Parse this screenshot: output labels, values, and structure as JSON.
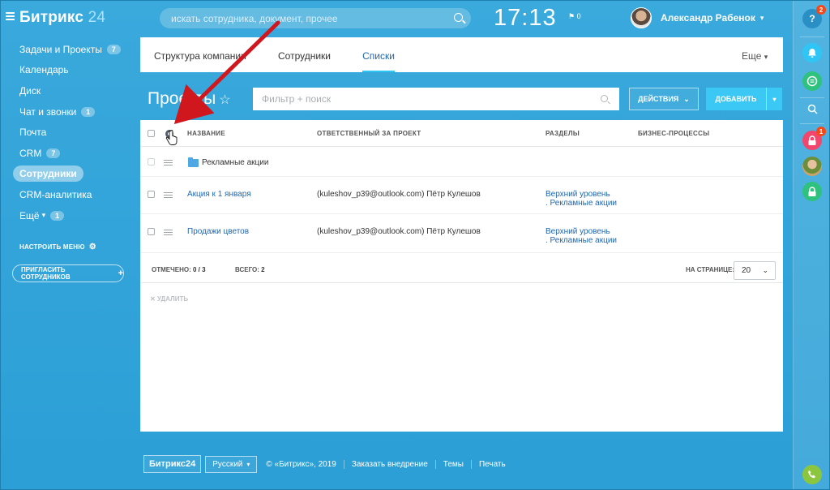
{
  "header": {
    "logo_main": "Битрикс",
    "logo_num": "24",
    "search_placeholder": "искать сотрудника, документ, прочее",
    "clock": "17:13",
    "flag": "⚑ 0",
    "user_name": "Александр Рабенок"
  },
  "menu": {
    "items": [
      {
        "label": "Задачи и Проекты",
        "count": "7"
      },
      {
        "label": "Календарь"
      },
      {
        "label": "Диск"
      },
      {
        "label": "Чат и звонки",
        "count": "1"
      },
      {
        "label": "Почта"
      },
      {
        "label": "CRM",
        "count": "7"
      },
      {
        "label": "Сотрудники",
        "active": true
      },
      {
        "label": "CRM-аналитика"
      },
      {
        "label": "Ещё",
        "count": "1"
      }
    ],
    "setup": "Настроить меню",
    "invite": "Пригласить сотрудников"
  },
  "tabs": {
    "items": [
      "Структура компании",
      "Сотрудники",
      "Списки"
    ],
    "more": "Еще"
  },
  "page": {
    "title": "Проекты",
    "filter_placeholder": "Фильтр + поиск",
    "actions_label": "Действия",
    "add_label": "Добавить"
  },
  "grid": {
    "columns": [
      "Название",
      "Ответственный за проект",
      "Разделы",
      "Бизнес-процессы"
    ],
    "folder_row": {
      "name": "Рекламные акции"
    },
    "rows": [
      {
        "name": "Акция к 1 января",
        "responsible": "(kuleshov_p39@outlook.com) Пётр Кулешов",
        "section1": "Верхний уровень",
        "section2": ". Рекламные акции"
      },
      {
        "name": "Продажи цветов",
        "responsible": "(kuleshov_p39@outlook.com) Пётр Кулешов",
        "section1": "Верхний уровень",
        "section2": ". Рекламные акции"
      }
    ],
    "footer": {
      "selected_label": "Отмечено:",
      "selected_value": "0 / 3",
      "total_label": "Всего:",
      "total_value": "2",
      "per_page_label": "На странице:",
      "per_page_value": "20"
    },
    "delete_label": "Удалить"
  },
  "footer": {
    "logo": "Битрикс24",
    "lang": "Русский",
    "copyright": "© «Битрикс», 2019",
    "links": [
      "Заказать внедрение",
      "Темы",
      "Печать"
    ]
  },
  "rightbar": {
    "help_badge": "2",
    "lock_badge": "1"
  },
  "colors": {
    "background": "#2fa4d9",
    "accent": "#3bc8f5",
    "link": "#2067b0",
    "arrow": "#d0171e"
  }
}
